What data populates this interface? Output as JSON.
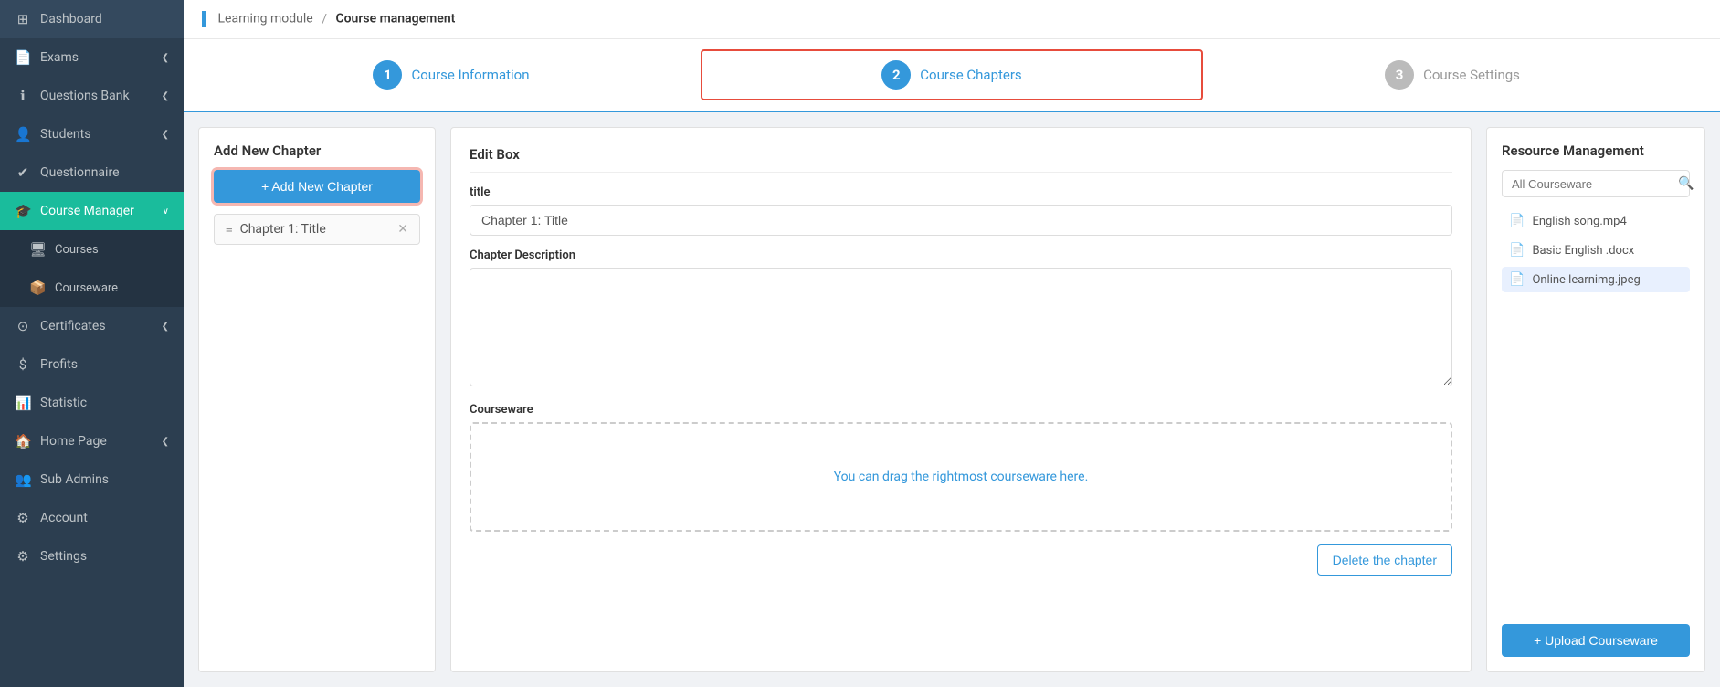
{
  "sidebar": {
    "items": [
      {
        "id": "dashboard",
        "label": "Dashboard",
        "icon": "⊞",
        "active": false
      },
      {
        "id": "exams",
        "label": "Exams",
        "icon": "📄",
        "active": false,
        "hasChevron": true
      },
      {
        "id": "questions-bank",
        "label": "Questions Bank",
        "icon": "ℹ",
        "active": false,
        "hasChevron": true
      },
      {
        "id": "students",
        "label": "Students",
        "icon": "👤",
        "active": false,
        "hasChevron": true
      },
      {
        "id": "questionnaire",
        "label": "Questionnaire",
        "icon": "✔",
        "active": false
      },
      {
        "id": "course-manager",
        "label": "Course Manager",
        "icon": "🎓",
        "active": true,
        "hasChevron": true
      },
      {
        "id": "courses",
        "label": "Courses",
        "icon": "🖥",
        "active": false,
        "sub": true
      },
      {
        "id": "courseware",
        "label": "Courseware",
        "icon": "📦",
        "active": false,
        "sub": true
      },
      {
        "id": "certificates",
        "label": "Certificates",
        "icon": "⊙",
        "active": false,
        "hasChevron": true
      },
      {
        "id": "profits",
        "label": "Profits",
        "icon": "$",
        "active": false
      },
      {
        "id": "statistic",
        "label": "Statistic",
        "icon": "📊",
        "active": false
      },
      {
        "id": "homepage",
        "label": "Home Page",
        "icon": "🏠",
        "active": false,
        "hasChevron": true
      },
      {
        "id": "sub-admins",
        "label": "Sub Admins",
        "icon": "👥",
        "active": false
      },
      {
        "id": "account",
        "label": "Account",
        "icon": "⚙",
        "active": false
      },
      {
        "id": "settings",
        "label": "Settings",
        "icon": "⚙",
        "active": false
      }
    ]
  },
  "breadcrumb": {
    "parent": "Learning module",
    "separator": "/",
    "current": "Course management"
  },
  "steps": [
    {
      "number": "1",
      "label": "Course Information",
      "style": "blue",
      "active": false
    },
    {
      "number": "2",
      "label": "Course Chapters",
      "style": "blue",
      "active": true
    },
    {
      "number": "3",
      "label": "Course Settings",
      "style": "gray",
      "active": false
    }
  ],
  "left_panel": {
    "title": "Add New Chapter",
    "add_button_label": "+ Add New Chapter",
    "chapters": [
      {
        "label": "Chapter 1: Title"
      }
    ]
  },
  "center_panel": {
    "title": "Edit Box",
    "title_label": "title",
    "title_placeholder": "Chapter 1: Title",
    "description_label": "Chapter Description",
    "courseware_label": "Courseware",
    "drop_hint": "You can drag the rightmost courseware here.",
    "delete_button": "Delete the chapter"
  },
  "right_panel": {
    "title": "Resource Management",
    "search_placeholder": "All Courseware",
    "resources": [
      {
        "name": "English song.mp4",
        "highlighted": false
      },
      {
        "name": "Basic English .docx",
        "highlighted": false
      },
      {
        "name": "Online learnimg.jpeg",
        "highlighted": true
      }
    ],
    "upload_button": "+ Upload Courseware"
  }
}
